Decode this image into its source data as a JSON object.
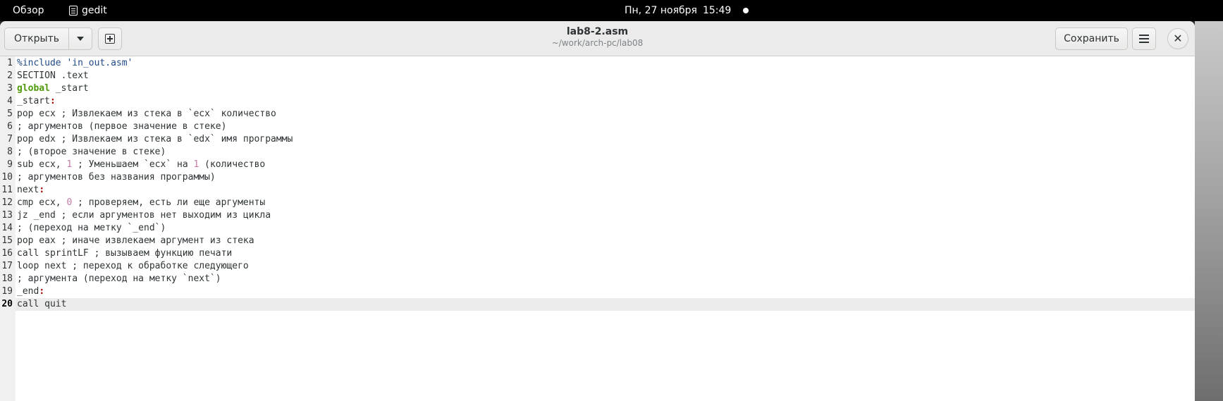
{
  "topbar": {
    "overview": "Обзор",
    "app_name": "gedit",
    "date": "Пн, 27 ноября",
    "time": "15:49"
  },
  "headerbar": {
    "open_label": "Открыть",
    "save_label": "Сохранить",
    "title": "lab8-2.asm",
    "subtitle": "~/work/arch-pc/lab08"
  },
  "editor": {
    "current_line": 20,
    "lines": [
      {
        "n": "1",
        "parts": [
          [
            "pp",
            "%include "
          ],
          [
            "str",
            "'in_out.asm'"
          ]
        ]
      },
      {
        "n": "2",
        "parts": [
          [
            "",
            "SECTION .text"
          ]
        ]
      },
      {
        "n": "3",
        "parts": [
          [
            "kw",
            "global"
          ],
          [
            "",
            " _start"
          ]
        ]
      },
      {
        "n": "4",
        "parts": [
          [
            "",
            "_start"
          ],
          [
            "col",
            ":"
          ]
        ]
      },
      {
        "n": "5",
        "parts": [
          [
            "",
            "pop ecx ; Извлекаем из стека в `ecx` количество"
          ]
        ]
      },
      {
        "n": "6",
        "parts": [
          [
            "",
            "; аргументов (первое значение в стеке)"
          ]
        ]
      },
      {
        "n": "7",
        "parts": [
          [
            "",
            "pop edx ; Извлекаем из стека в `edx` имя программы"
          ]
        ]
      },
      {
        "n": "8",
        "parts": [
          [
            "",
            "; (второе значение в стеке)"
          ]
        ]
      },
      {
        "n": "9",
        "parts": [
          [
            "",
            "sub ecx, "
          ],
          [
            "num",
            "1"
          ],
          [
            "",
            " ; Уменьшаем `ecx` на "
          ],
          [
            "num",
            "1"
          ],
          [
            "",
            " (количество"
          ]
        ]
      },
      {
        "n": "10",
        "parts": [
          [
            "",
            "; аргументов без названия программы)"
          ]
        ]
      },
      {
        "n": "11",
        "parts": [
          [
            "",
            "next"
          ],
          [
            "col",
            ":"
          ]
        ]
      },
      {
        "n": "12",
        "parts": [
          [
            "",
            "cmp ecx, "
          ],
          [
            "num",
            "0"
          ],
          [
            "",
            " ; проверяем, есть ли еще аргументы"
          ]
        ]
      },
      {
        "n": "13",
        "parts": [
          [
            "",
            "jz _end ; если аргументов нет выходим из цикла"
          ]
        ]
      },
      {
        "n": "14",
        "parts": [
          [
            "",
            "; (переход на метку `_end`)"
          ]
        ]
      },
      {
        "n": "15",
        "parts": [
          [
            "",
            "pop eax ; иначе извлекаем аргумент из стека"
          ]
        ]
      },
      {
        "n": "16",
        "parts": [
          [
            "",
            "call sprintLF ; вызываем функцию печати"
          ]
        ]
      },
      {
        "n": "17",
        "parts": [
          [
            "",
            "loop next ; переход к обработке следующего"
          ]
        ]
      },
      {
        "n": "18",
        "parts": [
          [
            "",
            "; аргумента (переход на метку `next`)"
          ]
        ]
      },
      {
        "n": "19",
        "parts": [
          [
            "",
            "_end"
          ],
          [
            "col",
            ":"
          ]
        ]
      },
      {
        "n": "20",
        "parts": [
          [
            "",
            "call quit"
          ]
        ]
      }
    ]
  }
}
